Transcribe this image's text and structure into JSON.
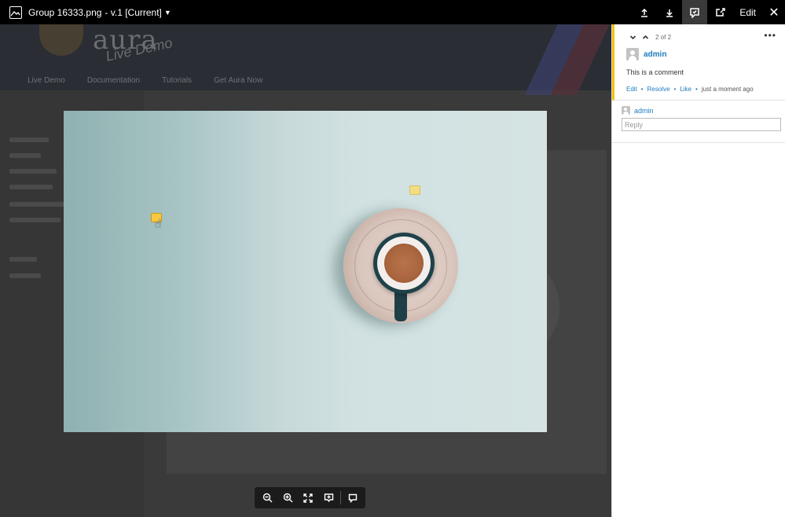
{
  "topbar": {
    "file_name": "Group 16333.png",
    "version": "- v.1 [Current]",
    "edit_label": "Edit"
  },
  "background": {
    "logo": "aura",
    "logo_sub": "Live Demo",
    "nav": [
      "Live Demo",
      "Documentation",
      "Tutorials",
      "Get Aura Now"
    ]
  },
  "comment": {
    "counter": "2 of 2",
    "author": "admin",
    "text": "This is a comment",
    "actions": {
      "edit": "Edit",
      "resolve": "Resolve",
      "like": "Like",
      "time": "just a moment ago"
    }
  },
  "reply": {
    "author": "admin",
    "placeholder": "Reply"
  },
  "icons": {
    "file": "image-file-icon",
    "upload": "upload-icon",
    "download": "download-icon",
    "comments": "comments-icon",
    "share": "share-icon",
    "close": "close-icon",
    "zoom_out": "zoom-out-icon",
    "zoom_in": "zoom-in-icon",
    "fit": "fit-screen-icon",
    "present": "present-icon",
    "comment": "comment-icon"
  },
  "colors": {
    "accent": "#1f7bbf",
    "comment_highlight": "#f2c200",
    "pin_active": "#f7c843"
  }
}
